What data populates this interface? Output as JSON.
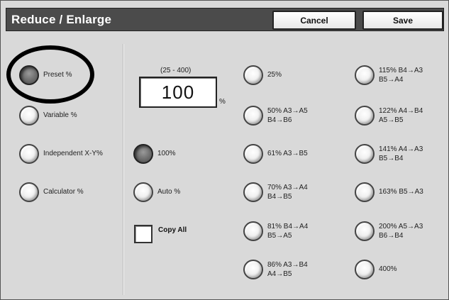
{
  "window": {
    "title": "Reduce / Enlarge",
    "cancel_label": "Cancel",
    "save_label": "Save"
  },
  "modes": [
    {
      "label": "Preset %",
      "selected": true
    },
    {
      "label": "Variable %",
      "selected": false
    },
    {
      "label": "Independent X-Y%",
      "selected": false
    },
    {
      "label": "Calculator %",
      "selected": false
    }
  ],
  "value": {
    "range": "(25 - 400)",
    "current": "100",
    "unit": "%"
  },
  "quick": [
    {
      "label": "100%",
      "selected": true
    },
    {
      "label": "Auto %",
      "selected": false
    }
  ],
  "copy_all": {
    "label": "Copy All",
    "checked": false
  },
  "presets_col1": [
    {
      "line1": "25%",
      "line2": ""
    },
    {
      "line1": "50% A3→A5",
      "line2": "B4→B6"
    },
    {
      "line1": "61% A3→B5",
      "line2": ""
    },
    {
      "line1": "70% A3→A4",
      "line2": "B4→B5"
    },
    {
      "line1": "81% B4→A4",
      "line2": "B5→A5"
    },
    {
      "line1": "86% A3→B4",
      "line2": "A4→B5"
    }
  ],
  "presets_col2": [
    {
      "line1": "115% B4→A3",
      "line2": "B5→A4"
    },
    {
      "line1": "122% A4→B4",
      "line2": "A5→B5"
    },
    {
      "line1": "141% A4→A3",
      "line2": "B5→B4"
    },
    {
      "line1": "163% B5→A3",
      "line2": ""
    },
    {
      "line1": "200% A5→A3",
      "line2": "B6→B4"
    },
    {
      "line1": "400%",
      "line2": ""
    }
  ],
  "colors": {
    "titlebar": "#4b4b4b",
    "panel": "#d9d9d9",
    "selected_radio": "#6e6e6e",
    "annotation_circle": "#000000"
  }
}
